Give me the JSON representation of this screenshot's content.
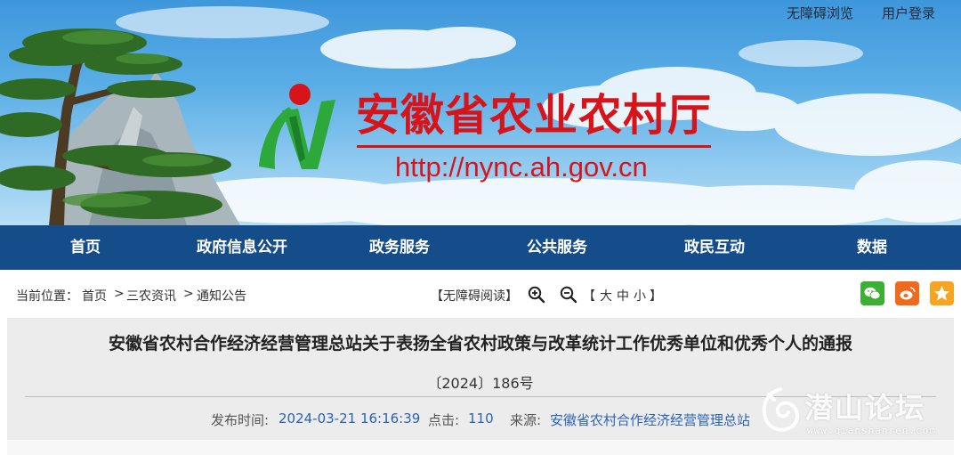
{
  "header": {
    "accessibility_link": "无障碍浏览",
    "login_link": "用户登录",
    "site_title": "安徽省农业农村厅",
    "site_url": "http://nync.ah.gov.cn"
  },
  "nav": {
    "items": [
      {
        "label": "首页"
      },
      {
        "label": "政府信息公开"
      },
      {
        "label": "政务服务"
      },
      {
        "label": "公共服务"
      },
      {
        "label": "政民互动"
      },
      {
        "label": "数据"
      }
    ]
  },
  "toolbar": {
    "location_label": "当前位置：",
    "breadcrumb": [
      "首页",
      "三农资讯",
      "通知公告"
    ],
    "separator": ">",
    "accessible_read": "【无障碍阅读】",
    "font_bracket_open": "【",
    "font_sizes": [
      "大",
      "中",
      "小"
    ],
    "font_bracket_close": "】",
    "icons": [
      "zoom-in-icon",
      "zoom-out-icon",
      "wechat-icon",
      "weibo-icon",
      "favorite-star-icon"
    ]
  },
  "article": {
    "title": "安徽省农村合作经济经营管理总站关于表扬全省农村政策与改革统计工作优秀单位和优秀个人的通报",
    "doc_number": "〔2024〕186号",
    "publish_label": "发布时间:",
    "publish_time": "2024-03-21 16:16:39",
    "clicks_label": "点击:",
    "clicks": "110",
    "source_label": "来源:",
    "source": "安徽省农村合作经济经营管理总站"
  },
  "watermark": {
    "name": "潜山论坛",
    "url": "www.qianshanren.com"
  },
  "colors": {
    "nav_bg": "#154d8a",
    "title_red": "#d8141b",
    "link_blue": "#2a63b7",
    "wechat_green": "#3cb034",
    "weibo_orange": "#f06a1d",
    "favorite_orange": "#f7a423"
  }
}
